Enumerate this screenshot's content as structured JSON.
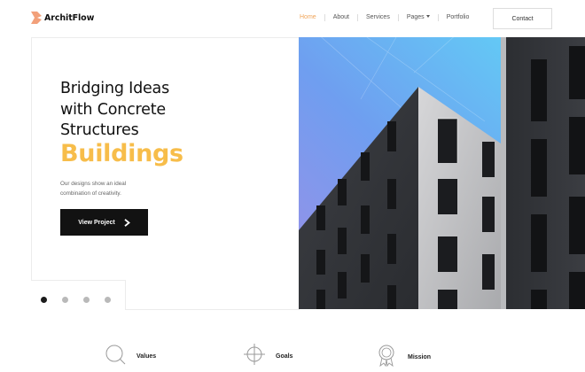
{
  "brand": {
    "name": "ArchitFlow",
    "accent_color": "#f0a55a"
  },
  "nav": {
    "items": [
      {
        "label": "Home",
        "active": true
      },
      {
        "label": "About",
        "active": false
      },
      {
        "label": "Services",
        "active": false
      },
      {
        "label": "Pages",
        "active": false,
        "dropdown": true
      },
      {
        "label": "Portfolio",
        "active": false
      }
    ],
    "contact_label": "Contact"
  },
  "hero": {
    "headline_lines": [
      "Bridging Ideas",
      "with Concrete",
      "Structures"
    ],
    "headline_accent": "Buildings",
    "accent_color": "#f7bd4a",
    "description_lines": [
      "Our designs show an ideal",
      "combination of creativity."
    ],
    "cta_label": "View Project",
    "slides": {
      "count": 4,
      "active_index": 0
    }
  },
  "features": [
    {
      "label": "Values",
      "icon": "magnifier-icon"
    },
    {
      "label": "Goals",
      "icon": "crosshair-icon"
    },
    {
      "label": "Mission",
      "icon": "award-ribbon-icon"
    }
  ]
}
